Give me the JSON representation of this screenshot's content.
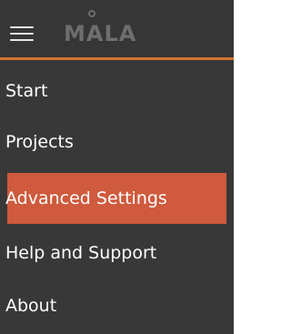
{
  "app": {
    "logo_text": "MALA",
    "menu_icon": "hamburger-menu-icon"
  },
  "colors": {
    "panel_background": "#383838",
    "accent_line": "#d6712f",
    "active_item_background": "#cf5a3d",
    "text": "#ffffff",
    "logo": "#6e6e6e"
  },
  "menu": {
    "items": [
      {
        "label": "Start",
        "active": false
      },
      {
        "label": "Projects",
        "active": false
      },
      {
        "label": "Advanced Settings",
        "active": true
      },
      {
        "label": "Help and Support",
        "active": false
      },
      {
        "label": "About",
        "active": false
      }
    ]
  }
}
